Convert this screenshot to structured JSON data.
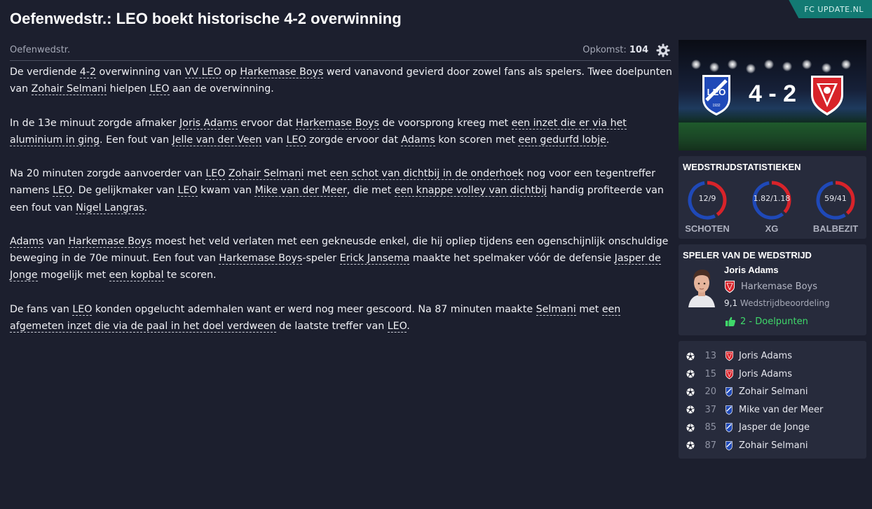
{
  "corner_badge": "FC UPDATE.NL",
  "headline": "Oefenwedstr.: LEO boekt historische 4-2 overwinning",
  "meta": {
    "category": "Oefenwedstr.",
    "attendance_label": "Opkomst:",
    "attendance_value": "104"
  },
  "article": {
    "p1": [
      "De verdiende ",
      "4-2",
      " overwinning van ",
      "VV LEO",
      " op ",
      "Harkemase Boys",
      " werd vanavond gevierd door zowel fans als spelers. Twee doelpunten van ",
      "Zohair Selmani",
      " hielpen ",
      "LEO",
      " aan de overwinning."
    ],
    "p2": [
      "In de 13e minuut zorgde afmaker ",
      "Joris Adams",
      " ervoor dat ",
      "Harkemase Boys",
      " de voorsprong kreeg met ",
      "een inzet die er via het aluminium in ging",
      ". Een fout van ",
      "Jelle van der Veen",
      " van ",
      "LEO",
      " zorgde ervoor dat ",
      "Adams",
      " kon scoren met ",
      "een gedurfd lobje",
      "."
    ],
    "p3": [
      "Na 20 minuten zorgde aanvoerder van ",
      "LEO",
      " ",
      "Zohair Selmani",
      " met ",
      "een schot van dichtbij in de onderhoek",
      " nog voor een tegentreffer namens ",
      "LEO",
      ". De gelijkmaker van ",
      "LEO",
      " kwam van ",
      "Mike van der Meer",
      ", die met ",
      "een knappe volley van dichtbij",
      " handig profiteerde van een fout van ",
      "Nigel Langras",
      "."
    ],
    "p4": [
      "",
      "Adams",
      " van ",
      "Harkemase Boys",
      " moest het veld verlaten met een gekneusde enkel, die hij opliep tijdens een ogenschijnlijk onschuldige beweging in de 70e minuut. Een fout van ",
      "Harkemase Boys",
      "-speler ",
      "Erick Jansema",
      " maakte het spelmaker vóór de defensie ",
      "Jasper de Jonge",
      " mogelijk met ",
      "een kopbal",
      " te scoren."
    ],
    "p5": [
      "De fans van ",
      "LEO",
      " konden opgelucht ademhalen want er werd nog meer gescoord. Na 87 minuten maakte ",
      "Selmani",
      " met ",
      "een afgemeten inzet die via de paal in het doel verdween",
      " de laatste treffer van ",
      "LEO",
      "."
    ]
  },
  "match": {
    "score": "4 - 2",
    "home_crest_icon": "leo-crest-icon",
    "away_crest_icon": "harkemase-boys-crest-icon",
    "home_color": "#1f49b8",
    "away_color": "#d8232a"
  },
  "stats": {
    "title": "WEDSTRIJDSTATISTIEKEN",
    "items": [
      {
        "label": "SCHOTEN",
        "value": "12/9",
        "home": 12,
        "away": 9
      },
      {
        "label": "XG",
        "value": "1.82/1.18",
        "home": 1.82,
        "away": 1.18
      },
      {
        "label": "BALBEZIT",
        "value": "59/41",
        "home": 59,
        "away": 41
      }
    ]
  },
  "motm": {
    "title": "SPELER VAN DE WEDSTRIJD",
    "player": "Joris Adams",
    "club": "Harkemase Boys",
    "rating_value": "9,1",
    "rating_label": "Wedstrijdbeoordeling",
    "goals": "2 - Doelpunten",
    "goals_color": "#3fd86a"
  },
  "scorers": [
    {
      "minute": "13",
      "team": "away",
      "name": "Joris Adams"
    },
    {
      "minute": "15",
      "team": "away",
      "name": "Joris Adams"
    },
    {
      "minute": "20",
      "team": "home",
      "name": "Zohair Selmani"
    },
    {
      "minute": "37",
      "team": "home",
      "name": "Mike van der Meer"
    },
    {
      "minute": "85",
      "team": "home",
      "name": "Jasper de Jonge"
    },
    {
      "minute": "87",
      "team": "home",
      "name": "Zohair Selmani"
    }
  ]
}
